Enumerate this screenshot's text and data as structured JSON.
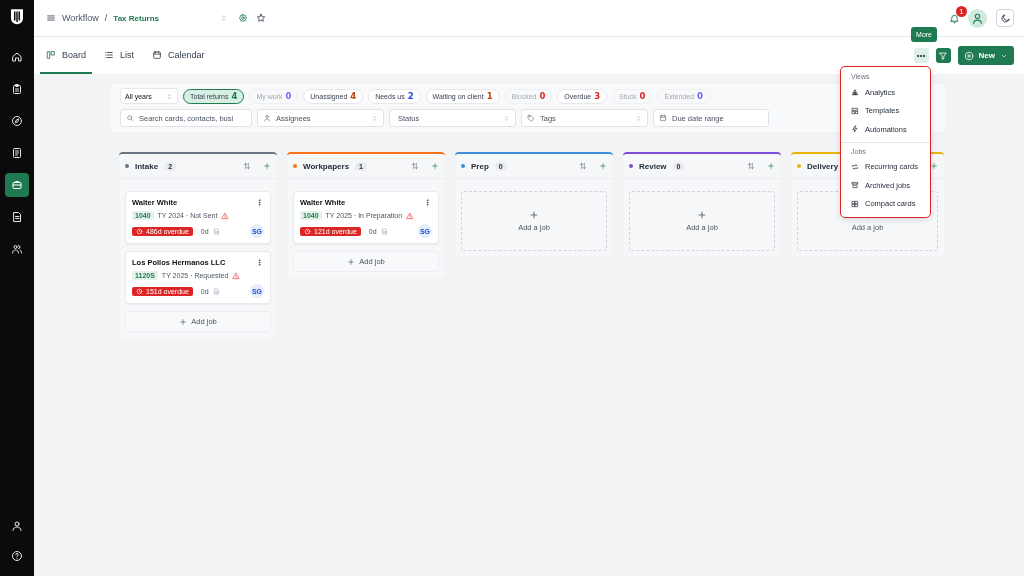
{
  "sidebar": {
    "items": [
      {
        "selected": false
      },
      {
        "selected": false
      },
      {
        "selected": false
      },
      {
        "selected": false
      },
      {
        "selected": true
      },
      {
        "selected": false
      },
      {
        "selected": false
      }
    ]
  },
  "breadcrumb": {
    "parent": "Workflow",
    "separator": "/",
    "current": "Tax Returns"
  },
  "notifications": {
    "count": "1"
  },
  "view_tabs": [
    {
      "label": "Board",
      "selected": true
    },
    {
      "label": "List",
      "selected": false
    },
    {
      "label": "Calendar",
      "selected": false
    }
  ],
  "toolbar": {
    "tooltip": "More",
    "new_button": "New"
  },
  "filters": {
    "year_select": "All years",
    "chips": [
      {
        "label": "Total returns",
        "count": "4",
        "color": "#1f7a52",
        "selected": true,
        "disabled": false
      },
      {
        "label": "My work",
        "count": "0",
        "color": "#8b5cf6",
        "selected": false,
        "disabled": true
      },
      {
        "label": "Unassigned",
        "count": "4",
        "color": "#c2410c",
        "selected": false,
        "disabled": false
      },
      {
        "label": "Needs us",
        "count": "2",
        "color": "#1d4ed8",
        "selected": false,
        "disabled": false
      },
      {
        "label": "Waiting on client",
        "count": "1",
        "color": "#c2410c",
        "selected": false,
        "disabled": false
      },
      {
        "label": "Blocked",
        "count": "0",
        "color": "#dc2626",
        "selected": false,
        "disabled": true
      },
      {
        "label": "Overdue",
        "count": "3",
        "color": "#dc2626",
        "selected": false,
        "disabled": false
      },
      {
        "label": "Stuck",
        "count": "0",
        "color": "#dc2626",
        "selected": false,
        "disabled": true
      },
      {
        "label": "Extended",
        "count": "0",
        "color": "#6366f1",
        "selected": false,
        "disabled": true
      }
    ],
    "fields": [
      {
        "kind": "search",
        "placeholder": "Search cards, contacts, busi"
      },
      {
        "kind": "assignee",
        "placeholder": "Assignees"
      },
      {
        "kind": "select",
        "placeholder": "Status"
      },
      {
        "kind": "tag",
        "placeholder": "Tags"
      },
      {
        "kind": "date",
        "placeholder": "Due date range"
      }
    ]
  },
  "columns": [
    {
      "name": "Intake",
      "count": "2",
      "color": "#6b7280",
      "cards": [
        {
          "title": "Walter White",
          "form": "1040",
          "meta": "TY 2024 · Not Sent",
          "overdue": "486d overdue",
          "days": "0d",
          "assignee": "SG"
        },
        {
          "title": "Los Pollos Hermanos LLC",
          "form": "1120S",
          "meta": "TY 2025 · Requested",
          "overdue": "151d overdue",
          "days": "0d",
          "assignee": "SG"
        }
      ],
      "add_label": "Add job"
    },
    {
      "name": "Workpapers",
      "count": "1",
      "color": "#f97316",
      "cards": [
        {
          "title": "Walter White",
          "form": "1040",
          "meta": "TY 2025 · In Preparation",
          "overdue": "121d overdue",
          "days": "0d",
          "assignee": "SG"
        }
      ],
      "add_label": "Add job"
    },
    {
      "name": "Prep",
      "count": "0",
      "color": "#3b8fdb",
      "add_label": "Add a job"
    },
    {
      "name": "Review",
      "count": "0",
      "color": "#7c4ddb",
      "add_label": "Add a job"
    },
    {
      "name": "Delivery",
      "color": "#eab308",
      "add_label": "Add a job"
    }
  ],
  "more_menu": {
    "sections": [
      {
        "title": "Views",
        "items": [
          {
            "label": "Analytics"
          },
          {
            "label": "Templates"
          },
          {
            "label": "Automations"
          }
        ]
      },
      {
        "title": "Jobs",
        "items": [
          {
            "label": "Recurring cards"
          },
          {
            "label": "Archived jobs"
          },
          {
            "label": "Compact cards"
          }
        ]
      }
    ]
  }
}
